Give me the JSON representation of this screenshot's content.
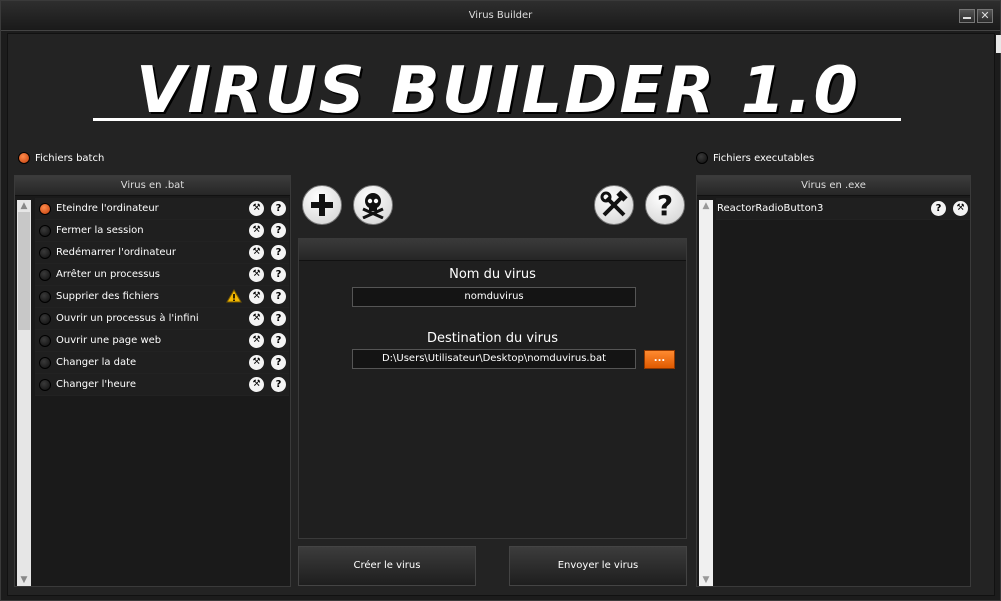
{
  "window": {
    "title": "Virus Builder",
    "close_label": "✕"
  },
  "logo": {
    "text": "VIRUS BUILDER 1.0"
  },
  "source": {
    "batch_label": "Fichiers batch",
    "exe_label": "Fichiers executables"
  },
  "left_panel": {
    "header": "Virus en .bat",
    "items": [
      {
        "label": "Eteindre l'ordinateur",
        "selected": true
      },
      {
        "label": "Fermer la session"
      },
      {
        "label": "Redémarrer l'ordinateur"
      },
      {
        "label": "Arrêter un processus"
      },
      {
        "label": "Supprier des fichiers",
        "warning": true
      },
      {
        "label": "Ouvrir un processus à l'infini"
      },
      {
        "label": "Ouvrir une page web"
      },
      {
        "label": "Changer la date"
      },
      {
        "label": "Changer l'heure"
      }
    ],
    "scroll_up": "▲",
    "scroll_down": "▼"
  },
  "right_panel": {
    "header": "Virus en .exe",
    "items": [
      {
        "label": "ReactorRadioButton3"
      }
    ],
    "scroll_up": "▲",
    "scroll_down": "▼"
  },
  "toolbar": {
    "add": "plus-icon",
    "skull": "skull-icon",
    "tools": "tools-icon",
    "help": "help-icon"
  },
  "form": {
    "name_label": "Nom du virus",
    "name_value": "nomduvirus",
    "dest_label": "Destination du virus",
    "dest_value": "D:\\Users\\Utilisateur\\Desktop\\nomduvirus.bat",
    "browse_label": "..."
  },
  "actions": {
    "create": "Créer le virus",
    "send": "Envoyer le virus"
  },
  "icons": {
    "help_glyph": "?",
    "tools_glyph": "⚒",
    "warning_glyph": "!"
  },
  "colors": {
    "accent": "#e8620f",
    "background": "#232323",
    "panel": "#1a1a1a"
  }
}
